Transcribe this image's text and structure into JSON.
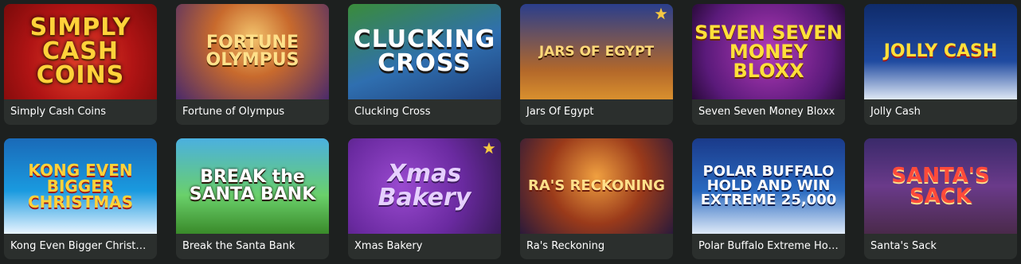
{
  "games": [
    {
      "title": "Simply Cash Coins",
      "logo_text": "SIMPLY CASH COINS",
      "theme": "t1",
      "logo_style": "a1"
    },
    {
      "title": "Fortune of Olympus",
      "logo_text": "FORTUNE OLYMPUS",
      "theme": "t2",
      "logo_style": "a2"
    },
    {
      "title": "Clucking Cross",
      "logo_text": "CLUCKING CROSS",
      "theme": "t3",
      "logo_style": "a3"
    },
    {
      "title": "Jars Of Egypt",
      "logo_text": "JARS OF EGYPT",
      "theme": "t4",
      "logo_style": "a4",
      "star": true
    },
    {
      "title": "Seven Seven Money Bloxx",
      "logo_text": "SEVEN SEVEN MONEY BLOXX",
      "theme": "t5",
      "logo_style": "a5"
    },
    {
      "title": "Jolly Cash",
      "logo_text": "JOLLY CASH",
      "theme": "t6",
      "logo_style": "a6"
    },
    {
      "title": "Kong Even Bigger Christmas",
      "logo_text": "KONG EVEN BIGGER CHRISTMAS",
      "theme": "t7",
      "logo_style": "a7"
    },
    {
      "title": "Break the Santa Bank",
      "logo_text": "BREAK the SANTA BANK",
      "theme": "t8",
      "logo_style": "a8"
    },
    {
      "title": "Xmas Bakery",
      "logo_text": "Xmas Bakery",
      "theme": "t9",
      "logo_style": "a9",
      "star": true
    },
    {
      "title": "Ra's Reckoning",
      "logo_text": "RA'S RECKONING",
      "theme": "t10",
      "logo_style": "a10"
    },
    {
      "title": "Polar Buffalo Extreme Hold ...",
      "logo_text": "POLAR BUFFALO HOLD AND WIN EXTREME 25,000",
      "theme": "t11",
      "logo_style": "a11"
    },
    {
      "title": "Santa's Sack",
      "logo_text": "SANTA'S SACK",
      "theme": "t12",
      "logo_style": "a12"
    }
  ],
  "icons": {
    "favorite": "star-icon"
  },
  "colors": {
    "page_bg": "#1d201f",
    "card_bg": "#2b2f2d",
    "label_text": "#ffffff",
    "star": "#f5c842"
  }
}
